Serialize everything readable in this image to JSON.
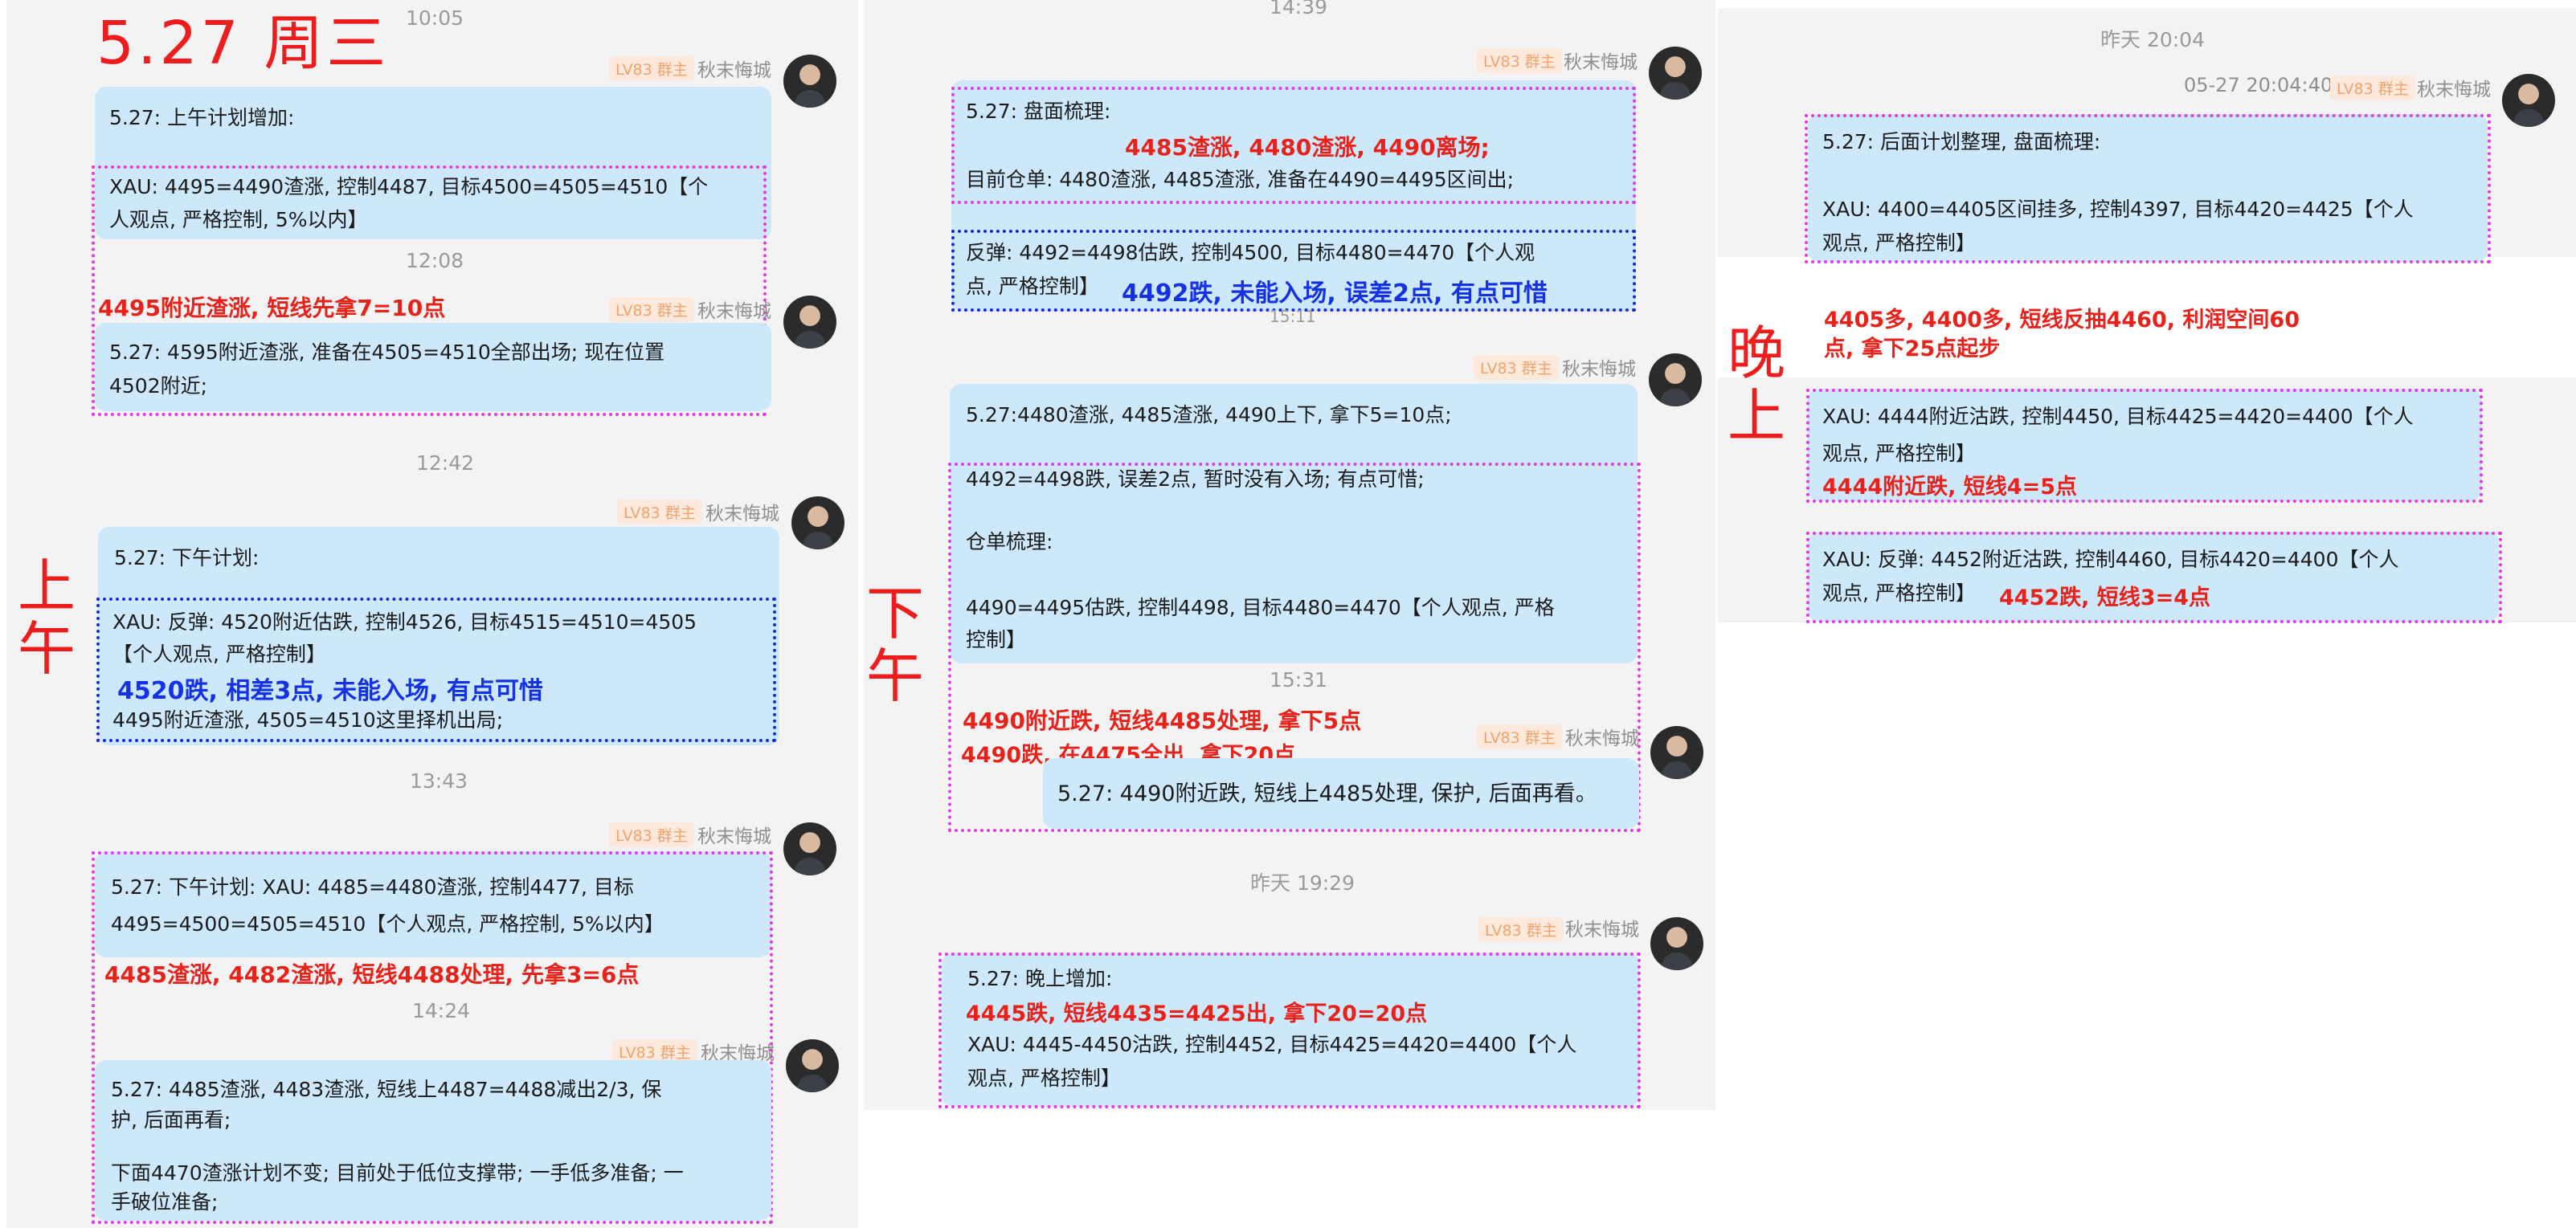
{
  "header": {
    "date_title": "5.27  周三"
  },
  "section_labels": {
    "morning": [
      "上",
      "午"
    ],
    "afternoon": [
      "下",
      "午"
    ],
    "evening": [
      "晚",
      "上"
    ]
  },
  "sender": {
    "badge": "LV83 群主",
    "name": "秋末悔城"
  },
  "col1": {
    "t1": "10:05",
    "m1": {
      "line1": "5.27:  上午计划增加:",
      "line2": "XAU: 4495=4490渣涨, 控制4487, 目标4500=4505=4510【个",
      "line3": "人观点, 严格控制, 5%以内】"
    },
    "t2": "12:08",
    "note1": "4495附近渣涨, 短线先拿7=10点",
    "m2": {
      "line1": "5.27:  4595附近渣涨, 准备在4505=4510全部出场; 现在位置",
      "line2": "4502附近;"
    },
    "t3": "12:42",
    "m3": {
      "line1": "5.27:  下午计划:",
      "line2": "XAU: 反弹: 4520附近估跌, 控制4526, 目标4515=4510=4505",
      "line3": "【个人观点, 严格控制】",
      "blue": "4520跌, 相差3点, 未能入场, 有点可惜",
      "line4": "4495附近渣涨, 4505=4510这里择机出局;"
    },
    "t4": "13:43",
    "m4": {
      "line1": "5.27:  下午计划: XAU: 4485=4480渣涨, 控制4477, 目标",
      "line2": "4495=4500=4505=4510【个人观点, 严格控制, 5%以内】",
      "red": "4485渣涨, 4482渣涨, 短线4488处理, 先拿3=6点"
    },
    "t5": "14:24",
    "m5": {
      "line1": "5.27:  4485渣涨, 4483渣涨, 短线上4487=4488减出2/3, 保",
      "line2": "护, 后面再看;",
      "line3": "下面4470渣涨计划不变; 目前处于低位支撑带; 一手低多准备; 一",
      "line4": "手破位准备;"
    }
  },
  "col2": {
    "t1": "14:39",
    "m1": {
      "line1": "5.27:  盘面梳理:",
      "red": "4485渣涨, 4480渣涨, 4490离场;",
      "line2": "目前仓单: 4480渣涨, 4485渣涨, 准备在4490=4495区间出;",
      "line3": "反弹: 4492=4498估跌, 控制4500, 目标4480=4470【个人观",
      "line4": "点, 严格控制】",
      "blue": "4492跌, 未能入场, 误差2点, 有点可惜"
    },
    "t2": "15:11",
    "m2": {
      "line1": "5.27:4480渣涨, 4485渣涨, 4490上下, 拿下5=10点;",
      "line2": "4492=4498跌, 误差2点, 暂时没有入场; 有点可惜;",
      "line3": "仓单梳理:",
      "line4": "4490=4495估跌, 控制4498, 目标4480=4470【个人观点, 严格",
      "line5": "控制】"
    },
    "t3": "15:31",
    "red1": "4490附近跌, 短线4485处理, 拿下5点",
    "red2": "4490跌, 在4475全出, 拿下20点",
    "m3": {
      "line1": "5.27:  4490附近跌, 短线上4485处理, 保护, 后面再看。"
    },
    "t4": "昨天 19:29",
    "m4": {
      "line1": "5.27:  晚上增加:",
      "red": "4445跌, 短线4435=4425出, 拿下20=20点",
      "line2": "XAU: 4445-4450沽跌, 控制4452, 目标4425=4420=4400【个人",
      "line3": "观点, 严格控制】"
    }
  },
  "col3": {
    "t1": "昨天 20:04",
    "t1b": "05-27 20:04:40",
    "m1": {
      "line1": "5.27:  后面计划整理, 盘面梳理:",
      "line2": "XAU: 4400=4405区间挂多, 控制4397, 目标4420=4425【个人",
      "line3": "观点, 严格控制】"
    },
    "note1": "4405多, 4400多, 短线反抽4460, 利润空间60",
    "note2": "点, 拿下25点起步",
    "m2": {
      "line1": "XAU: 4444附近沽跌, 控制4450, 目标4425=4420=4400【个人",
      "line2": "观点, 严格控制】",
      "red": "4444附近跌, 短线4=5点"
    },
    "m3": {
      "line1": "XAU: 反弹: 4452附近沽跌, 控制4460, 目标4420=4400【个人",
      "line2": "观点, 严格控制】",
      "red": "4452跌, 短线3=4点"
    }
  }
}
